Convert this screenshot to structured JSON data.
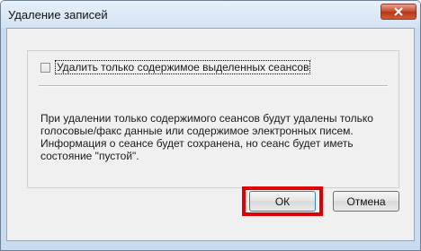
{
  "dialog": {
    "title": "Удаление записей",
    "close_icon": "close-x-icon",
    "close_color": "#c8462c"
  },
  "options": {
    "checkbox_label": "Удалить только содержимое выделенных сеансов",
    "checked": false
  },
  "info_text": "При удалении только содержимого сеансов будут удалены только голосовые/факс данные или содержимое электронных писем. Информация о сеансе будет сохранена, но сеанс будет иметь состояние \"пустой\".",
  "buttons": {
    "ok_label": "ОК",
    "cancel_label": "Отмена",
    "highlight_color": "#e00000"
  }
}
